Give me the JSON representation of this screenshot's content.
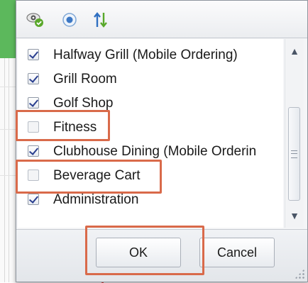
{
  "toolbar": {
    "icons": [
      "visibility-settings-icon",
      "radio-dot-icon",
      "sort-icon"
    ]
  },
  "list": {
    "items": [
      {
        "label": "Halfway Grill (Mobile Ordering)",
        "checked": true
      },
      {
        "label": "Grill Room",
        "checked": true
      },
      {
        "label": "Golf Shop",
        "checked": true
      },
      {
        "label": "Fitness",
        "checked": false
      },
      {
        "label": "Clubhouse Dining (Mobile Orderin",
        "checked": true
      },
      {
        "label": "Beverage Cart",
        "checked": false
      },
      {
        "label": "Administration",
        "checked": true
      }
    ]
  },
  "buttons": {
    "ok_label": "OK",
    "cancel_label": "Cancel"
  },
  "colors": {
    "highlight": "#d96a4a",
    "background_accent": "#5cb85c"
  }
}
